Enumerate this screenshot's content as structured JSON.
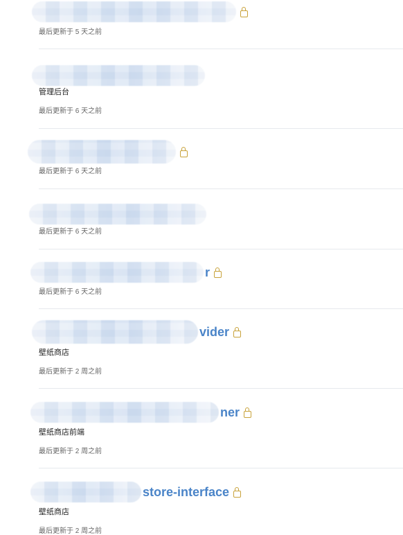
{
  "repositories": [
    {
      "name_tail": "",
      "description": "",
      "updated": "最后更新于 5 天之前",
      "private": true
    },
    {
      "name_tail": "",
      "description": "管理后台",
      "updated": "最后更新于 6 天之前",
      "private": false
    },
    {
      "name_tail": "",
      "description": "",
      "updated": "最后更新于 6 天之前",
      "private": true
    },
    {
      "name_tail": "",
      "description": "",
      "updated": "最后更新于 6 天之前",
      "private": false
    },
    {
      "name_tail": "r",
      "description": "",
      "updated": "最后更新于 6 天之前",
      "private": true
    },
    {
      "name_tail": "vider",
      "description": "壁纸商店",
      "updated": "最后更新于 2 周之前",
      "private": true
    },
    {
      "name_tail": "ner",
      "description": "壁纸商店前端",
      "updated": "最后更新于 2 周之前",
      "private": true
    },
    {
      "name_tail": "store-interface",
      "description": "壁纸商店",
      "updated": "最后更新于 2 周之前",
      "private": true
    }
  ],
  "icons": {
    "lock": "lock-icon"
  },
  "colors": {
    "link": "#4a84c8",
    "lock": "#c8a23a",
    "divider": "#e6e9ed"
  }
}
